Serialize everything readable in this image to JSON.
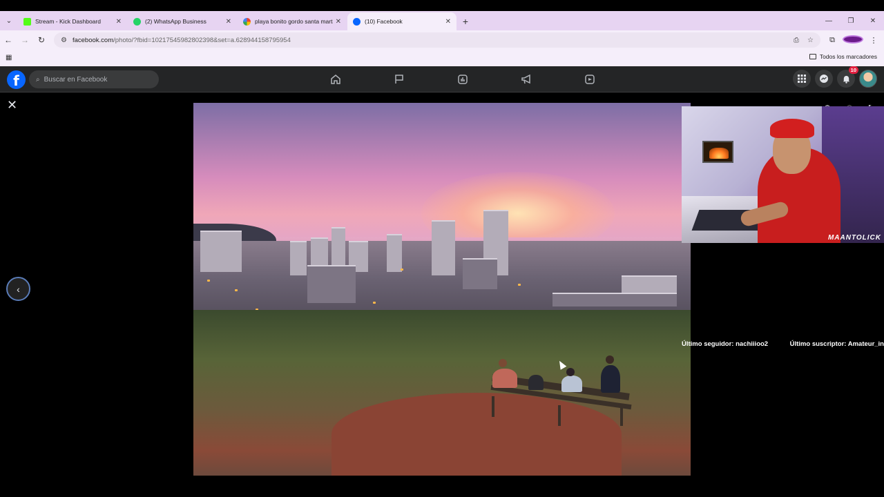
{
  "browser": {
    "tabs": [
      {
        "label": "Stream - Kick Dashboard",
        "favicon_color": "#53fc18",
        "active": false
      },
      {
        "label": "(2) WhatsApp Business",
        "favicon_color": "#25d366",
        "active": false
      },
      {
        "label": "playa bonito gordo santa marta",
        "favicon_color": "#4285f4",
        "active": false
      },
      {
        "label": "(10) Facebook",
        "favicon_color": "#0866ff",
        "active": true
      }
    ],
    "url_domain": "facebook.com",
    "url_path": "/photo/?fbid=10217545982802398&set=a.628944158795954",
    "bookmarks_label": "Todos los marcadores"
  },
  "facebook": {
    "logo": "f",
    "search_placeholder": "Buscar en Facebook",
    "nav_icons": [
      "home-icon",
      "flag-icon",
      "dashboard-icon",
      "megaphone-icon",
      "video-icon"
    ],
    "notification_count": "10"
  },
  "viewer": {
    "close_icon": "close-icon",
    "prev_icon": "chevron-left-icon",
    "photo_description": ""
  },
  "stream_overlay": {
    "signature": "MAANTOLICK",
    "last_follower": "Último seguidor: nachiiioo2",
    "last_subscriber": "Último suscriptor: Amateur_in"
  }
}
